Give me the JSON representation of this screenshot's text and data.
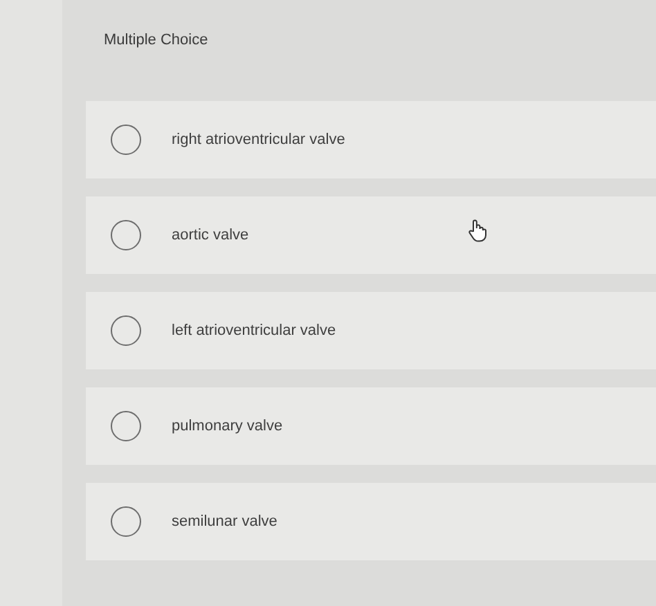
{
  "question": {
    "title": "Multiple Choice",
    "options": [
      {
        "label": "right atrioventricular valve",
        "selected": false
      },
      {
        "label": "aortic valve",
        "selected": false
      },
      {
        "label": "left atrioventricular valve",
        "selected": false
      },
      {
        "label": "pulmonary valve",
        "selected": false
      },
      {
        "label": "semilunar valve",
        "selected": false
      }
    ]
  }
}
